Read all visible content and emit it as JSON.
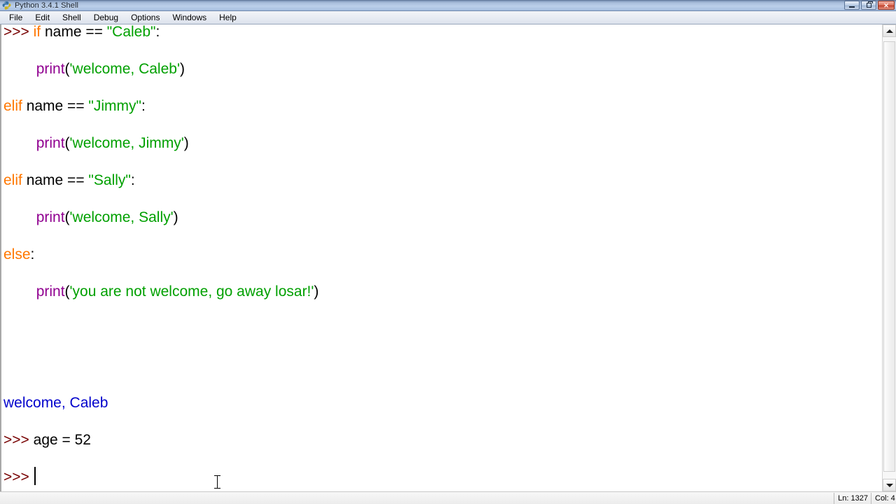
{
  "window": {
    "title": "Python 3.4.1 Shell",
    "icon": "python-logo-icon",
    "controls": {
      "minimize": "minimize-button",
      "restore": "restore-button",
      "close": "close-button"
    }
  },
  "menubar": {
    "items": [
      {
        "label": "File"
      },
      {
        "label": "Edit"
      },
      {
        "label": "Shell"
      },
      {
        "label": "Debug"
      },
      {
        "label": "Options"
      },
      {
        "label": "Windows"
      },
      {
        "label": "Help"
      }
    ]
  },
  "shell": {
    "lines": [
      {
        "id": "line-if-caleb",
        "clipped": true,
        "tokens": [
          {
            "text": ">>> ",
            "type": "prompt"
          },
          {
            "text": "if",
            "type": "keyword"
          },
          {
            "text": " name == ",
            "type": "plain"
          },
          {
            "text": "\"Caleb\"",
            "type": "string"
          },
          {
            "text": ":",
            "type": "plain"
          }
        ]
      },
      {
        "id": "line-print-caleb",
        "tokens": [
          {
            "text": "        ",
            "type": "plain"
          },
          {
            "text": "print",
            "type": "builtin"
          },
          {
            "text": "(",
            "type": "plain"
          },
          {
            "text": "'welcome, Caleb'",
            "type": "string"
          },
          {
            "text": ")",
            "type": "plain"
          }
        ]
      },
      {
        "id": "line-elif-jimmy",
        "tokens": [
          {
            "text": "elif",
            "type": "keyword"
          },
          {
            "text": " name == ",
            "type": "plain"
          },
          {
            "text": "\"Jimmy\"",
            "type": "string"
          },
          {
            "text": ":",
            "type": "plain"
          }
        ]
      },
      {
        "id": "line-print-jimmy",
        "tokens": [
          {
            "text": "        ",
            "type": "plain"
          },
          {
            "text": "print",
            "type": "builtin"
          },
          {
            "text": "(",
            "type": "plain"
          },
          {
            "text": "'welcome, Jimmy'",
            "type": "string"
          },
          {
            "text": ")",
            "type": "plain"
          }
        ]
      },
      {
        "id": "line-elif-sally",
        "tokens": [
          {
            "text": "elif",
            "type": "keyword"
          },
          {
            "text": " name == ",
            "type": "plain"
          },
          {
            "text": "\"Sally\"",
            "type": "string"
          },
          {
            "text": ":",
            "type": "plain"
          }
        ]
      },
      {
        "id": "line-print-sally",
        "tokens": [
          {
            "text": "        ",
            "type": "plain"
          },
          {
            "text": "print",
            "type": "builtin"
          },
          {
            "text": "(",
            "type": "plain"
          },
          {
            "text": "'welcome, Sally'",
            "type": "string"
          },
          {
            "text": ")",
            "type": "plain"
          }
        ]
      },
      {
        "id": "line-else",
        "tokens": [
          {
            "text": "else",
            "type": "keyword"
          },
          {
            "text": ":",
            "type": "plain"
          }
        ]
      },
      {
        "id": "line-print-else",
        "tokens": [
          {
            "text": "        ",
            "type": "plain"
          },
          {
            "text": "print",
            "type": "builtin"
          },
          {
            "text": "(",
            "type": "plain"
          },
          {
            "text": "'you are not welcome, go away losar!'",
            "type": "string"
          },
          {
            "text": ")",
            "type": "plain"
          }
        ]
      },
      {
        "id": "line-blank-1",
        "tokens": []
      },
      {
        "id": "line-blank-2",
        "tokens": []
      },
      {
        "id": "line-output-welcome",
        "tokens": [
          {
            "text": "welcome, Caleb",
            "type": "output"
          }
        ]
      },
      {
        "id": "line-age-assign",
        "tokens": [
          {
            "text": ">>> ",
            "type": "prompt"
          },
          {
            "text": "age = 52",
            "type": "plain"
          }
        ]
      },
      {
        "id": "line-prompt-active",
        "caret": true,
        "tokens": [
          {
            "text": ">>>",
            "type": "prompt"
          }
        ]
      }
    ]
  },
  "statusbar": {
    "line_label": "Ln: 1327",
    "col_label": "Col: 4"
  },
  "colors": {
    "keyword": "#ff7700",
    "string": "#00a000",
    "builtin": "#900090",
    "prompt": "#770000",
    "output": "#0000cc",
    "plain": "#000000",
    "background": "#ffffff"
  }
}
